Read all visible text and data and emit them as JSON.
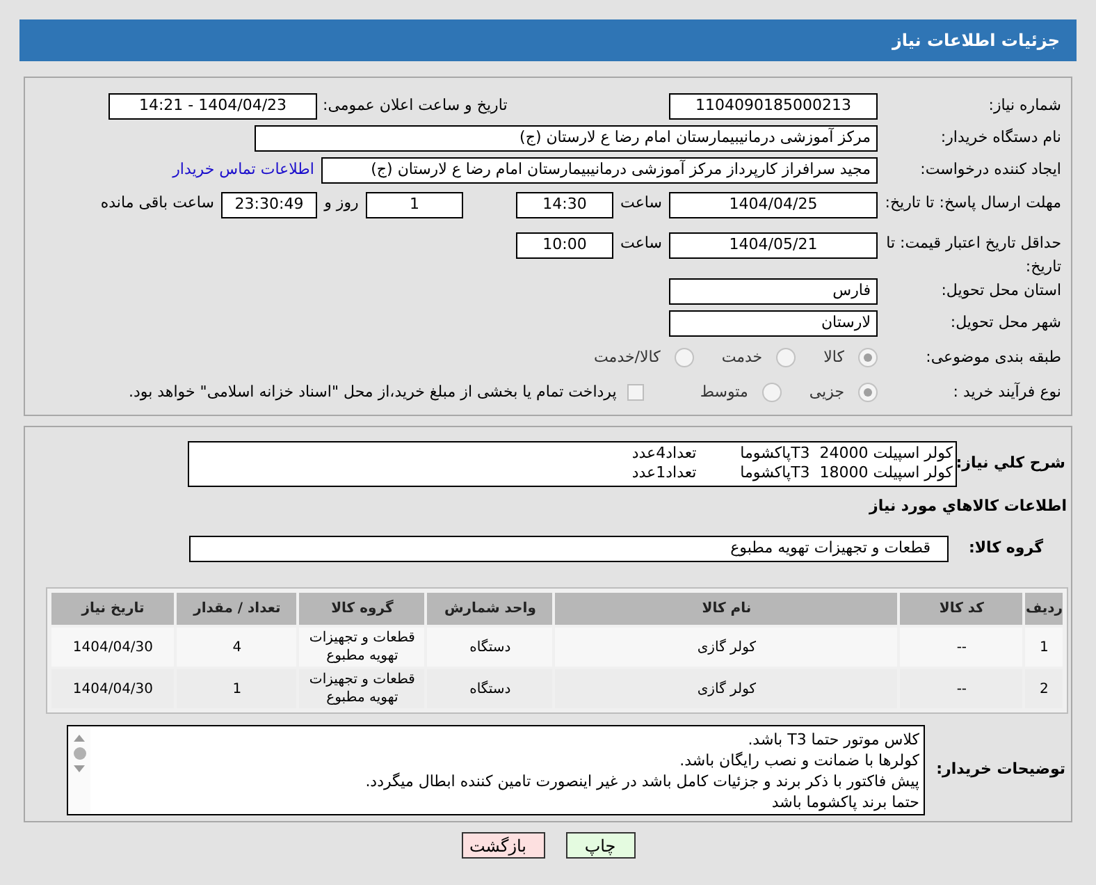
{
  "title": "جزئیات اطلاعات نیاز",
  "need_number": {
    "label": "شماره نیاز:",
    "value": "1104090185000213"
  },
  "announce": {
    "label": "تاریخ و ساعت اعلان عمومی:",
    "value": "1404/04/23 - 14:21"
  },
  "buyer_org": {
    "label": "نام دستگاه خریدار:",
    "value": "مرکز آموزشی درمانیبیمارستان امام رضا  ع  لارستان (ج)"
  },
  "creator": {
    "label": "ایجاد کننده درخواست:",
    "value": "مجید سرافراز کارپرداز  مرکز آموزشی درمانیبیمارستان امام رضا  ع  لارستان (ج)",
    "link": "اطلاعات تماس خریدار"
  },
  "deadline": {
    "label": "مهلت ارسال پاسخ: تا تاریخ:",
    "date": "1404/04/25",
    "time_label": "ساعت",
    "time": "14:30",
    "days": "1",
    "days_label": "روز و",
    "remaining": "23:30:49",
    "remaining_label": "ساعت باقی مانده"
  },
  "validity": {
    "label": "حداقل تاریخ اعتبار قیمت: تا تاریخ:",
    "date": "1404/05/21",
    "time_label": "ساعت",
    "time": "10:00"
  },
  "province": {
    "label": "استان محل تحویل:",
    "value": "فارس"
  },
  "city": {
    "label": "شهر محل تحویل:",
    "value": "لارستان"
  },
  "category": {
    "label": "طبقه بندی موضوعی:",
    "options": [
      {
        "label": "کالا",
        "selected": true
      },
      {
        "label": "خدمت",
        "selected": false
      },
      {
        "label": "کالا/خدمت",
        "selected": false
      }
    ]
  },
  "purchase_type": {
    "label": "نوع فرآیند خرید :",
    "options": [
      {
        "label": "جزیی",
        "selected": true
      },
      {
        "label": "متوسط",
        "selected": false
      }
    ],
    "treasury": {
      "checked": false,
      "label": "پرداخت تمام یا بخشی از مبلغ خرید،از محل \"اسناد خزانه اسلامی\" خواهد بود."
    }
  },
  "description": {
    "label": "شرح کلي نياز:",
    "lines": [
      "کولر اسپیلت 24000  T3پاکشوما         تعداد4عدد",
      "کولر اسپیلت 18000  T3پاکشوما         تعداد1عدد"
    ]
  },
  "items_heading": "اطلاعات کالاهاي مورد نياز",
  "goods_group": {
    "label": "گروه کالا:",
    "value": "قطعات و تجهیزات تهویه مطبوع"
  },
  "table": {
    "columns": [
      "ردیف",
      "کد کالا",
      "نام کالا",
      "واحد شمارش",
      "گروه کالا",
      "تعداد / مقدار",
      "تاریخ نیاز"
    ],
    "rows": [
      [
        "1",
        "--",
        "کولر گازی",
        "دستگاه",
        "قطعات و تجهیزات تهویه مطبوع",
        "4",
        "1404/04/30"
      ],
      [
        "2",
        "--",
        "کولر گازی",
        "دستگاه",
        "قطعات و تجهیزات تهویه مطبوع",
        "1",
        "1404/04/30"
      ]
    ]
  },
  "buyer_notes": {
    "label": "توضیحات خریدار:",
    "lines": [
      "کلاس موتور حتما T3 باشد.",
      "کولرها با ضمانت و نصب رایگان باشد.",
      "پیش فاکتور با ذکر برند و جزئیات کامل باشد در غیر اینصورت تامین کننده ابطال میگردد.",
      "حتما برند پاکشوما باشد"
    ]
  },
  "buttons": [
    {
      "kind": "print",
      "label": "چاپ"
    },
    {
      "kind": "back",
      "label": "بازگشت"
    }
  ]
}
